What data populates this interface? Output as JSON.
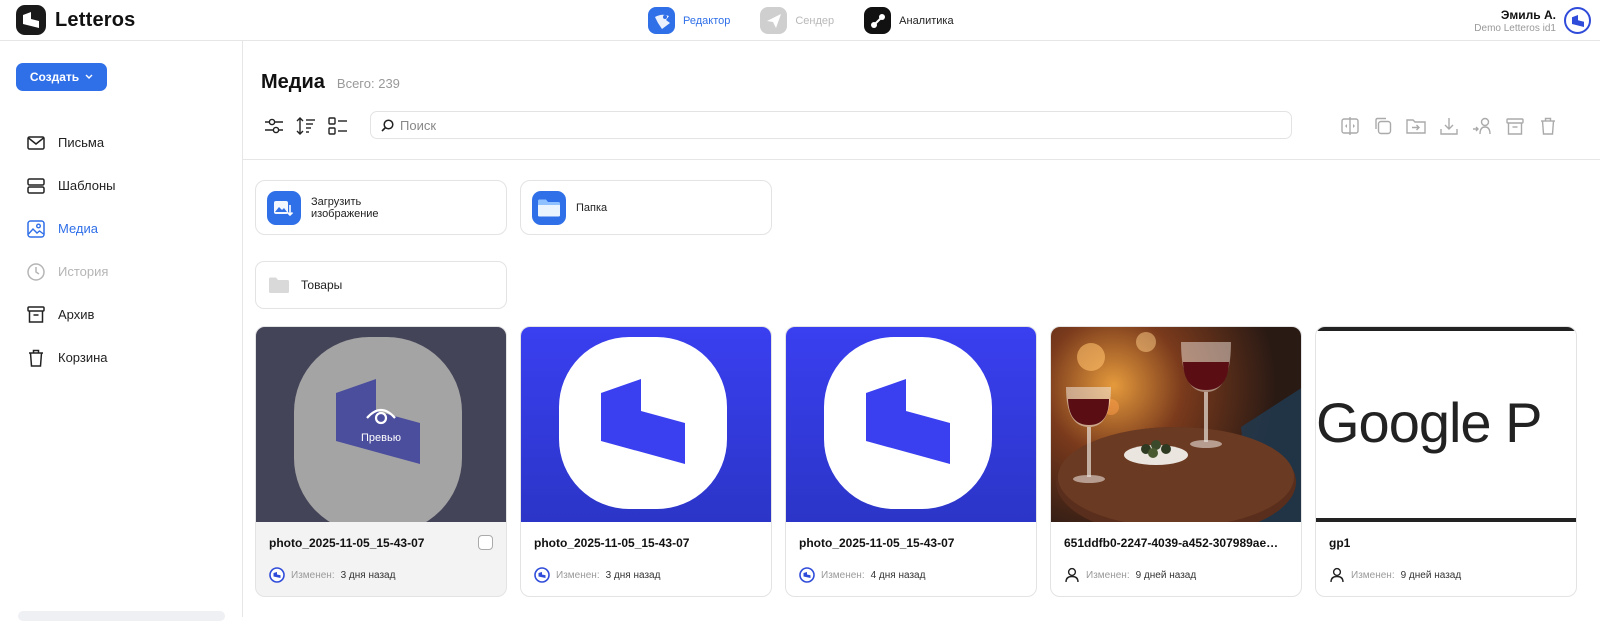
{
  "brand": {
    "name": "Letteros"
  },
  "apps": [
    {
      "label": "Редактор",
      "state": "active"
    },
    {
      "label": "Сендер",
      "state": "disabled"
    },
    {
      "label": "Аналитика",
      "state": "normal"
    }
  ],
  "user": {
    "name": "Эмиль А.",
    "org": "Demo Letteros id1"
  },
  "sidebar": {
    "create_label": "Создать",
    "items": [
      {
        "label": "Письма",
        "icon": "mail-icon"
      },
      {
        "label": "Шаблоны",
        "icon": "templates-icon"
      },
      {
        "label": "Медиа",
        "icon": "media-icon",
        "active": true
      },
      {
        "label": "История",
        "icon": "clock-icon",
        "disabled": true
      },
      {
        "label": "Архив",
        "icon": "archive-icon"
      },
      {
        "label": "Корзина",
        "icon": "trash-icon"
      }
    ]
  },
  "main": {
    "title": "Медиа",
    "count": "Всего: 239",
    "search_placeholder": "Поиск",
    "upload_label_line1": "Загрузить",
    "upload_label_line2": "изображение",
    "folder_create_label": "Папка",
    "folders": [
      {
        "name": "Товары"
      }
    ],
    "preview_label": "Превью",
    "changed_label": "Изменен:",
    "files": [
      {
        "name": "photo_2025-11-05_15-43-07",
        "changed": "3 дня назад",
        "author": "logo"
      },
      {
        "name": "photo_2025-11-05_15-43-07",
        "changed": "3 дня назад",
        "author": "logo"
      },
      {
        "name": "photo_2025-11-05_15-43-07",
        "changed": "4 дня назад",
        "author": "logo"
      },
      {
        "name": "651ddfb0-2247-4039-a452-307989ae…",
        "changed": "9 дней назад",
        "author": "user"
      },
      {
        "name": "gp1",
        "changed": "9 дней назад",
        "author": "user"
      }
    ],
    "gp_thumb_text": "Google P"
  },
  "colors": {
    "accent": "#2f6fe8",
    "logo_blue": "#3a3ff0",
    "dark_tile": "#2c2b5a"
  }
}
